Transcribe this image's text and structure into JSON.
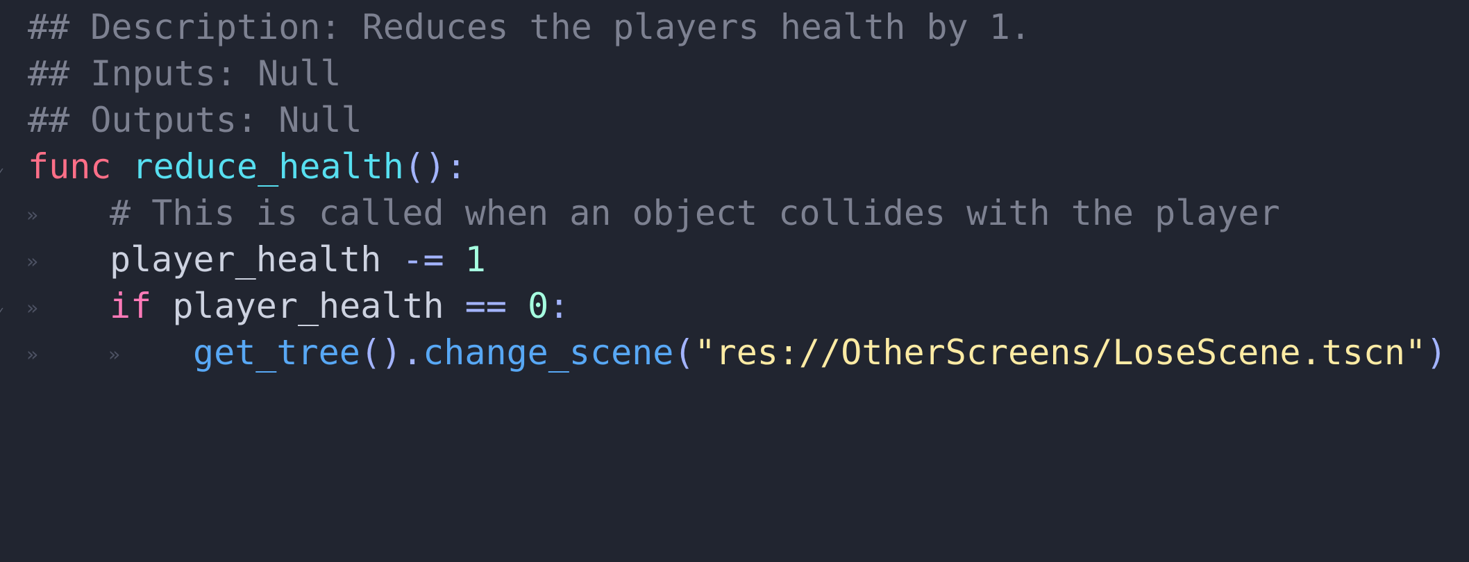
{
  "editor": {
    "lines": [
      {
        "comment": "## Description: Reduces the players health by 1."
      },
      {
        "comment": "## Inputs: Null"
      },
      {
        "comment": "## Outputs: Null"
      },
      {
        "keyword": "func",
        "function_name": "reduce_health",
        "parens": "()",
        "colon": ":"
      },
      {
        "comment": "# This is called when an object collides with the player"
      },
      {
        "identifier": "player_health",
        "operator": "-=",
        "number": "1"
      },
      {
        "keyword": "if",
        "identifier": "player_health",
        "operator": "==",
        "number": "0",
        "colon": ":"
      },
      {
        "call1": "get_tree",
        "parens1": "()",
        "dot": ".",
        "call2": "change_scene",
        "open_paren": "(",
        "string": "\"res://OtherScreens/LoseScene.tscn\"",
        "close_paren": ")"
      }
    ],
    "tab_glyph": "»",
    "fold_glyph": "⌄"
  }
}
